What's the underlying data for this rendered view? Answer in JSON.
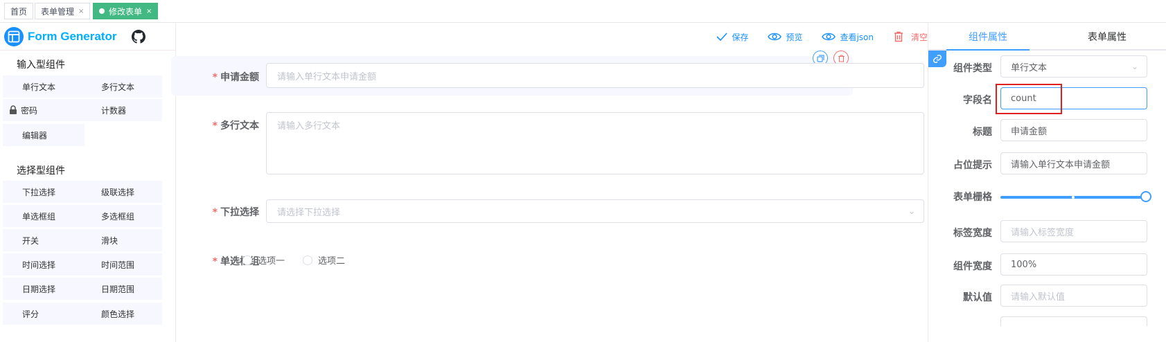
{
  "tabs": [
    {
      "label": "首页",
      "closable": false,
      "active": false
    },
    {
      "label": "表单管理",
      "closable": true,
      "active": false
    },
    {
      "label": "修改表单",
      "closable": true,
      "active": true
    }
  ],
  "tab_close_glyph": "×",
  "logo": {
    "text": "Form Generator",
    "icon": "form-logo-icon",
    "github_icon": "github-icon"
  },
  "left": {
    "input_group_title": "输入型组件",
    "input_components": [
      "单行文本",
      "多行文本",
      "密码",
      "计数器",
      "编辑器"
    ],
    "select_group_title": "选择型组件",
    "select_components": [
      "下拉选择",
      "级联选择",
      "单选框组",
      "多选框组",
      "开关",
      "滑块",
      "时间选择",
      "时间范围",
      "日期选择",
      "日期范围",
      "评分",
      "颜色选择"
    ]
  },
  "toolbar": {
    "save": "保存",
    "preview": "预览",
    "view_json": "查看json",
    "clear": "清空"
  },
  "form": {
    "amount": {
      "label": "申请金额",
      "placeholder": "请输入单行文本申请金额"
    },
    "textarea": {
      "label": "多行文本",
      "placeholder": "请输入多行文本"
    },
    "select": {
      "label": "下拉选择",
      "placeholder": "请选择下拉选择"
    },
    "radio": {
      "label": "单选框组",
      "options": [
        "选项一",
        "选项二"
      ]
    },
    "required_mark": "*"
  },
  "right": {
    "tabs": [
      "组件属性",
      "表单属性"
    ],
    "fields": {
      "type": {
        "label": "组件类型",
        "value": "单行文本"
      },
      "field_name": {
        "label": "字段名",
        "value": "count"
      },
      "title": {
        "label": "标题",
        "value": "申请金额"
      },
      "placeholder": {
        "label": "占位提示",
        "value": "请输入单行文本申请金额"
      },
      "grid": {
        "label": "表单栅格",
        "value_fraction": 1.0
      },
      "label_width": {
        "label": "标签宽度",
        "placeholder": "请输入标签宽度"
      },
      "component_width": {
        "label": "组件宽度",
        "value": "100%"
      },
      "default_value": {
        "label": "默认值",
        "placeholder": "请输入默认值"
      }
    }
  },
  "colors": {
    "primary": "#409eff",
    "danger": "#f56c6c",
    "active_tab": "#42b983",
    "logo_text": "#00afff",
    "highlight_box": "#e02020"
  }
}
